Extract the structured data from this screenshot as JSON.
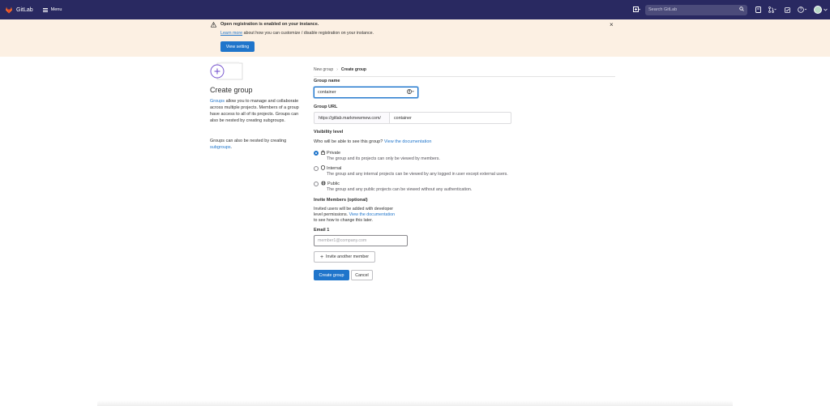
{
  "topbar": {
    "brand": "GitLab",
    "menu_label": "Menu",
    "search_placeholder": "Search GitLab",
    "search_shortcut": "/"
  },
  "banner": {
    "title": "Open registration is enabled on your instance.",
    "learn_more": "Learn more",
    "desc_rest": " about how you can customize / disable registration on your instance.",
    "button": "View setting",
    "close": "×"
  },
  "left": {
    "title": "Create group",
    "p1_link": "Groups",
    "p1_rest": " allow you to manage and collaborate across multiple projects. Members of a group have access to all of its projects. Groups can also be nested by creating subgroups.",
    "p2_text": "Groups can also be nested by creating ",
    "p2_link": "subgroups",
    "p2_end": "."
  },
  "breadcrumb": {
    "parent": "New group",
    "sep": "›",
    "current": "Create group"
  },
  "form": {
    "group_name_label": "Group name",
    "group_name_value": "container",
    "group_url_label": "Group URL",
    "url_prefix": "https://gitlab.markmewmew.com/",
    "url_value": "container",
    "visibility_label": "Visibility level",
    "visibility_question": "Who will be able to see this group?",
    "visibility_doc_link": "View the documentation",
    "visibility": [
      {
        "name": "Private",
        "desc": "The group and its projects can only be viewed by members.",
        "checked": true
      },
      {
        "name": "Internal",
        "desc": "The group and any internal projects can be viewed by any logged in user except external users.",
        "checked": false
      },
      {
        "name": "Public",
        "desc": "The group and any public projects can be viewed without any authentication.",
        "checked": false
      }
    ],
    "invite_label": "Invite Members (optional)",
    "invite_line1": "Invited users will be added with developer",
    "invite_line2": "level permissions.",
    "invite_doc_link": "View the documentation",
    "invite_line3": "to see how to change this later.",
    "email_label": "Email 1",
    "email_placeholder": "member1@company.com",
    "invite_another": "Invite another member",
    "create_button": "Create group",
    "cancel_button": "Cancel"
  },
  "colors": {
    "navbar": "#292961",
    "banner_bg": "#fcf0e3",
    "primary": "#1f75cb"
  }
}
